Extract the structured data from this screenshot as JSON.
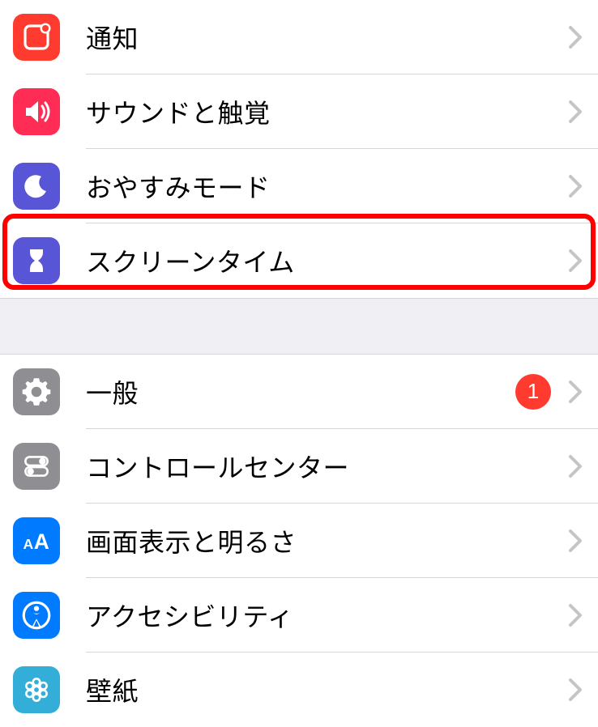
{
  "group1": [
    {
      "label": "通知",
      "icon": "notifications-icon",
      "bg": "bg-red"
    },
    {
      "label": "サウンドと触覚",
      "icon": "sounds-icon",
      "bg": "bg-pink"
    },
    {
      "label": "おやすみモード",
      "icon": "dnd-icon",
      "bg": "bg-purple"
    },
    {
      "label": "スクリーンタイム",
      "icon": "screentime-icon",
      "bg": "bg-purple"
    }
  ],
  "group2": [
    {
      "label": "一般",
      "icon": "general-icon",
      "bg": "bg-gray",
      "badge": "1"
    },
    {
      "label": "コントロールセンター",
      "icon": "control-center-icon",
      "bg": "bg-gray"
    },
    {
      "label": "画面表示と明るさ",
      "icon": "display-icon",
      "bg": "bg-blue"
    },
    {
      "label": "アクセシビリティ",
      "icon": "accessibility-icon",
      "bg": "bg-blue"
    },
    {
      "label": "壁紙",
      "icon": "wallpaper-icon",
      "bg": "bg-cyan"
    }
  ],
  "highlighted": "スクリーンタイム"
}
